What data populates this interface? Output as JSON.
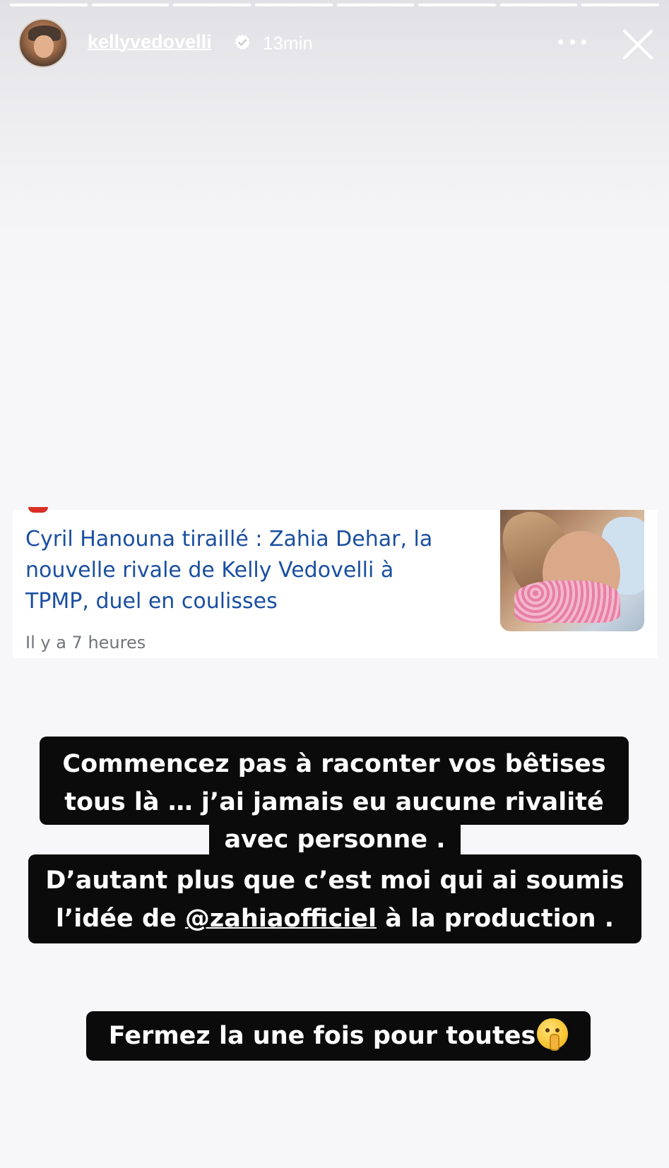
{
  "story": {
    "progress": [
      1,
      1,
      1,
      1,
      1,
      1,
      1,
      1
    ],
    "user": {
      "username": "kellyvedovelli",
      "verified": true,
      "time_ago": "13min"
    }
  },
  "article": {
    "title": "Cyril Hanouna tiraillé : Zahia Dehar, la nouvelle rivale de Kelly Vedovelli à TPMP, duel en coulisses",
    "time": "Il y a 7 heures"
  },
  "captions": {
    "line1": "Commencez pas à raconter vos bêtises",
    "line2": "tous là … j’ai jamais eu aucune rivalité",
    "line3": "avec personne .",
    "line4": "D’autant plus que c’est moi qui ai soumis",
    "line5_before": "l’idée de ",
    "line5_handle": "@zahiaofficiel",
    "line5_after": " à la production .",
    "line6": "Fermez la une fois pour toutes",
    "line6_emoji": "shushing-face-emoji"
  },
  "colors": {
    "link_blue": "#1a4fa0",
    "caption_bg": "#0b0b0b",
    "verified": "#ffffff"
  }
}
